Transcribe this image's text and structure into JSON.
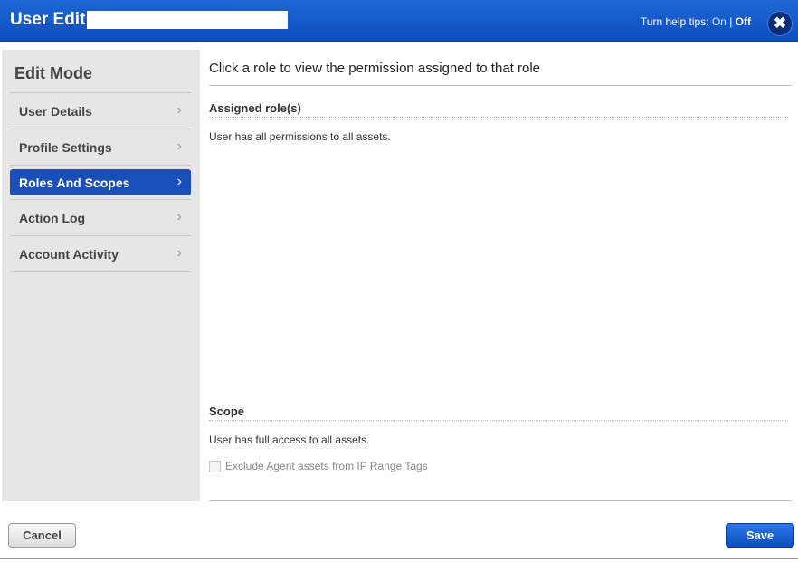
{
  "dialog": {
    "title": "User Edit:",
    "help_tips_label": "Turn help tips:",
    "help_on": "On",
    "help_sep": "|",
    "help_off": "Off",
    "close_glyph": "✖"
  },
  "sidebar": {
    "heading": "Edit Mode",
    "items": [
      {
        "label": "User Details"
      },
      {
        "label": "Profile Settings"
      },
      {
        "label": "Roles And Scopes",
        "active": true
      },
      {
        "label": "Action Log"
      },
      {
        "label": "Account Activity"
      }
    ],
    "chevron": "›"
  },
  "main": {
    "headline": "Click a role to view the permission assigned to that role",
    "assigned_title": "Assigned role(s)",
    "assigned_text": "User has all permissions to all assets.",
    "scope_title": "Scope",
    "scope_text": "User has full access to all assets.",
    "exclude_label": "Exclude Agent assets from IP Range Tags"
  },
  "footer": {
    "cancel_label": "Cancel",
    "save_label": "Save"
  },
  "colors": {
    "titlebar": "#0b4fbf",
    "active_nav": "#1a4fb9",
    "sidebar_bg": "#e6e6e6"
  }
}
